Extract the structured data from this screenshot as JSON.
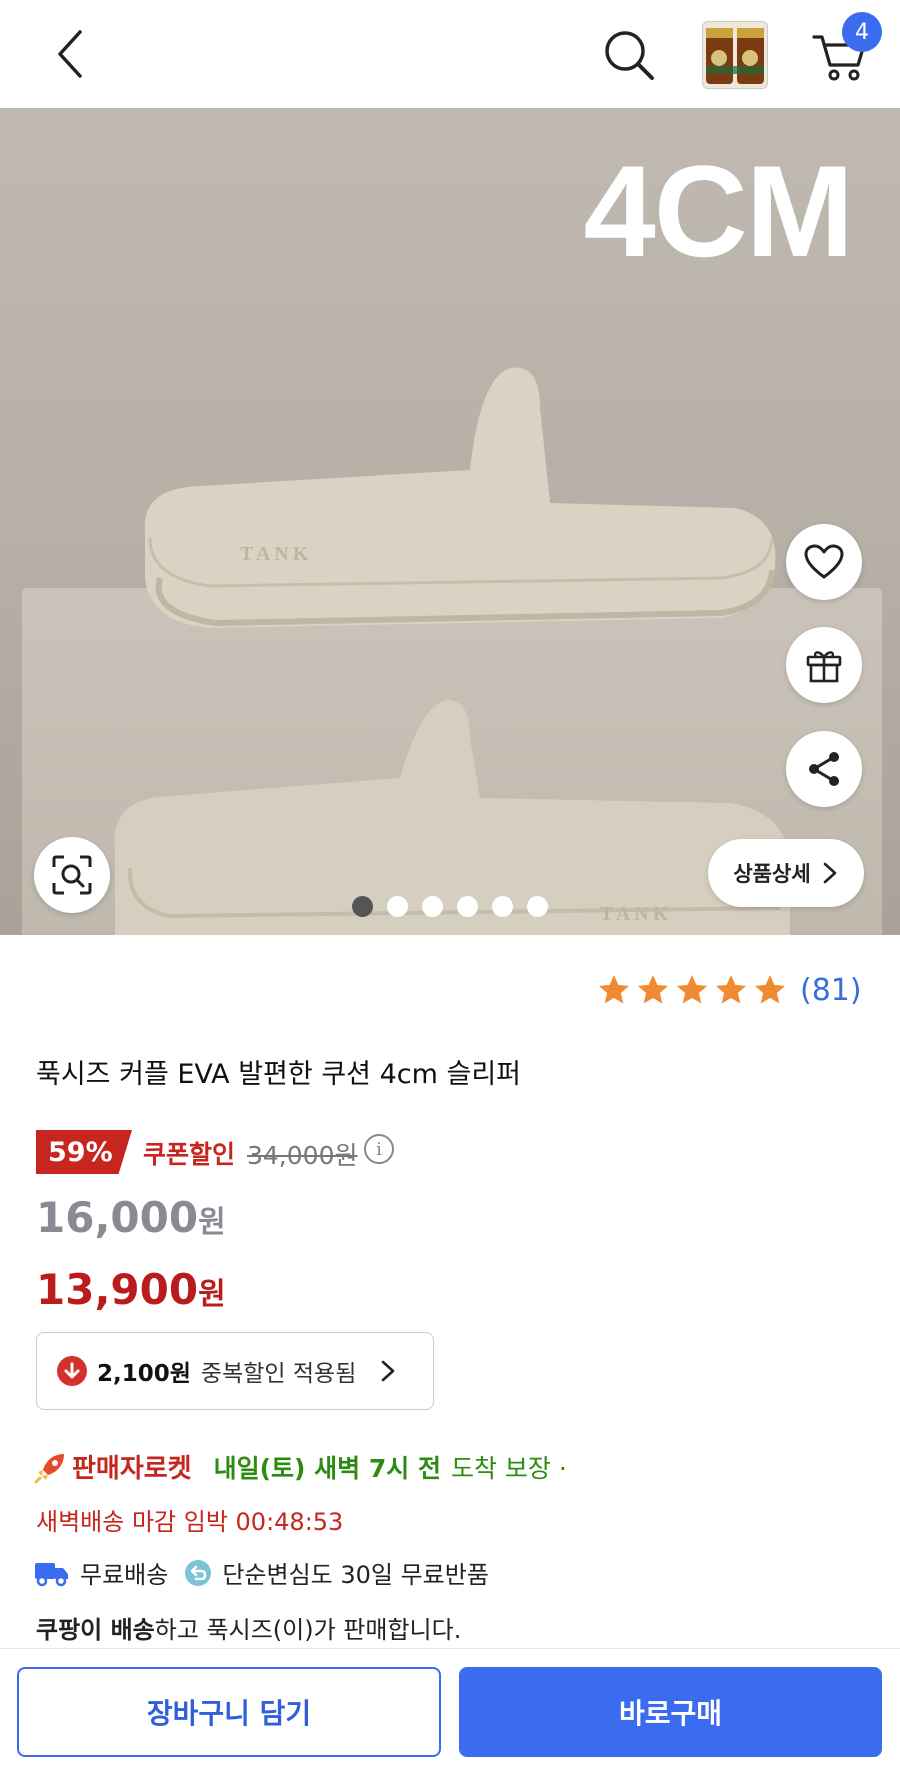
{
  "header": {
    "cart_count": "4",
    "thumbnail_icon": "product-thumbnail"
  },
  "hero": {
    "overlay_text": "4CM",
    "detail_label": "상품상세",
    "dots_total": 6,
    "active_dot": 0,
    "slipper_brand": "TANK"
  },
  "rating": {
    "stars": 5,
    "count": "(81)",
    "star_color": "#f08b34"
  },
  "product": {
    "title": "푹시즈 커플 EVA 발편한 쿠션 4cm 슬리퍼",
    "discount_percent": "59%",
    "coupon_label": "쿠폰할인",
    "original_price": "34,000원",
    "sale_price_value": "16,000",
    "sale_price_unit": "원",
    "final_price_value": "13,900",
    "final_price_unit": "원",
    "extra_discount_amount": "2,100원",
    "extra_discount_text": "중복할인 적용됨"
  },
  "delivery": {
    "rocket_label": "판매자로켓",
    "arrival_bold": "내일(토) 새벽 7시 전",
    "arrival_text": "도착 보장 ·",
    "cutoff": "새벽배송 마감 임박 00:48:53",
    "free_shipping": "무료배송",
    "free_return": "단순변심도 30일 무료반품",
    "sold_by_bold": "쿠팡이 배송",
    "sold_by_text": "하고 푹시즈(이)가 판매합니다."
  },
  "actions": {
    "add_to_cart": "장바구니 담기",
    "buy_now": "바로구매"
  },
  "colors": {
    "accent_blue": "#3b6cf0",
    "price_red": "#b81c1c",
    "green": "#2e8b12"
  }
}
